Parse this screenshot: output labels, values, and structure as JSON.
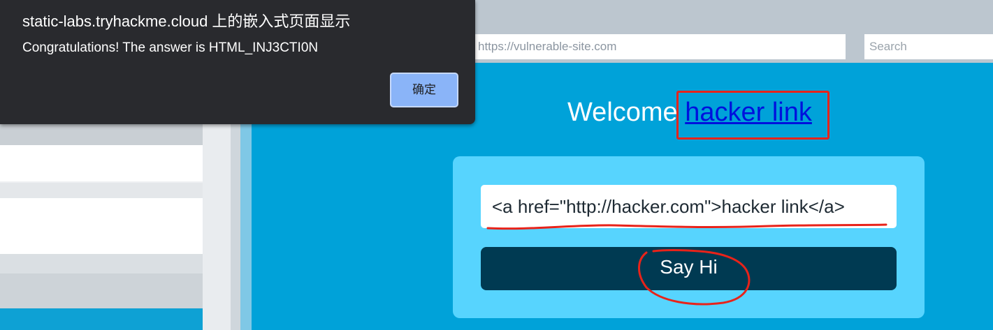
{
  "dialog": {
    "title": "static-labs.tryhackme.cloud 上的嵌入式页面显示",
    "message_prefix": "Congratulations! The answer is ",
    "answer": "HTML_INJ3CTI0N",
    "ok_label": "确定"
  },
  "browser": {
    "url": "https://vulnerable-site.com",
    "search_placeholder": "Search"
  },
  "page": {
    "welcome_text": "Welcome ",
    "link_text": "hacker link",
    "input_value": "<a href=\"http://hacker.com\">hacker link</a>",
    "button_label": "Say Hi"
  },
  "colors": {
    "page_bg": "#00a2d9",
    "card_bg": "#57d4fe",
    "button_bg": "#003a52",
    "annotation": "#e8231a",
    "dialog_bg": "#292a2e",
    "ok_button": "#8ab4f8"
  }
}
